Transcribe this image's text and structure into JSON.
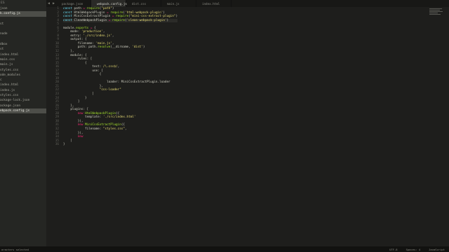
{
  "sidebar": {
    "title": "ES",
    "items": [
      {
        "label": "json"
      },
      {
        "label": "k.config.js",
        "active": true
      },
      {
        "label": ""
      },
      {
        "label": "st"
      },
      {
        "label": ""
      },
      {
        "label": "node"
      },
      {
        "label": ""
      },
      {
        "label": "dbox"
      },
      {
        "label": "st"
      },
      {
        "label": "index.html"
      },
      {
        "label": "main.css"
      },
      {
        "label": "main.js"
      },
      {
        "label": "styles.css"
      },
      {
        "label": "ode_modules"
      },
      {
        "label": "c"
      },
      {
        "label": "index.html"
      },
      {
        "label": "index.js"
      },
      {
        "label": "styles.css"
      },
      {
        "label": "ackage-lock.json"
      },
      {
        "label": "ackage.json"
      },
      {
        "label": "ebpack.config.js",
        "active": true
      }
    ]
  },
  "tabs": {
    "prev_icon": "◀",
    "next_icon": "▶",
    "items": [
      {
        "label": "package.json"
      },
      {
        "label": "webpack.config.js",
        "active": true
      },
      {
        "label": "dist.css"
      },
      {
        "label": "main.js"
      },
      {
        "label": "index.html"
      }
    ]
  },
  "code": {
    "current_line": 4,
    "lines": [
      [
        [
          "kw",
          "const"
        ],
        [
          "prop",
          " path "
        ],
        [
          "op",
          "="
        ],
        [
          "prop",
          " "
        ],
        [
          "fn",
          "require"
        ],
        [
          "prop",
          "("
        ],
        [
          "str",
          "\"path\""
        ],
        [
          "prop",
          ")"
        ]
      ],
      [
        [
          "kw",
          "const"
        ],
        [
          "prop",
          " HtmlWebpackPlugin "
        ],
        [
          "op",
          "="
        ],
        [
          "prop",
          " "
        ],
        [
          "fn",
          "require"
        ],
        [
          "prop",
          "("
        ],
        [
          "str",
          "'html-webpack-plugin'"
        ],
        [
          "prop",
          ")"
        ]
      ],
      [
        [
          "kw",
          "const"
        ],
        [
          "prop",
          " MiniCssExtractPlugin "
        ],
        [
          "op",
          "="
        ],
        [
          "prop",
          " "
        ],
        [
          "fn",
          "require"
        ],
        [
          "prop",
          "("
        ],
        [
          "str",
          "\"mini-css-extract-plugin\""
        ],
        [
          "prop",
          ")"
        ]
      ],
      [
        [
          "kw",
          "const"
        ],
        [
          "prop",
          " CleanWebpackPlugin "
        ],
        [
          "op",
          "="
        ],
        [
          "prop",
          " "
        ],
        [
          "fn",
          "require"
        ],
        [
          "prop",
          "("
        ],
        [
          "str",
          "'clean-webpack-plugin'"
        ],
        [
          "prop",
          ")"
        ]
      ],
      [
        [
          "prop",
          ""
        ]
      ],
      [
        [
          "prop",
          "module."
        ],
        [
          "fn",
          "exports"
        ],
        [
          "prop",
          " "
        ],
        [
          "op",
          "="
        ],
        [
          "prop",
          " {"
        ]
      ],
      [
        [
          "prop",
          "    mode: "
        ],
        [
          "str",
          "'production'"
        ],
        [
          "prop",
          ","
        ]
      ],
      [
        [
          "prop",
          "    entry: "
        ],
        [
          "str",
          "'./src/index.js'"
        ],
        [
          "prop",
          ","
        ]
      ],
      [
        [
          "prop",
          "    output: {"
        ]
      ],
      [
        [
          "prop",
          "        filename: "
        ],
        [
          "str",
          "'main.js'"
        ],
        [
          "prop",
          ","
        ]
      ],
      [
        [
          "prop",
          "        path: path."
        ],
        [
          "fn",
          "resolve"
        ],
        [
          "prop",
          "(__dirname, "
        ],
        [
          "str",
          "'dist'"
        ],
        [
          "prop",
          ")"
        ]
      ],
      [
        [
          "prop",
          "    },"
        ]
      ],
      [
        [
          "prop",
          "    module: {"
        ]
      ],
      [
        [
          "prop",
          "        rules: ["
        ]
      ],
      [
        [
          "prop",
          "            {"
        ]
      ],
      [
        [
          "prop",
          "                test: "
        ],
        [
          "str",
          "/\\.css$/"
        ],
        [
          "prop",
          ","
        ]
      ],
      [
        [
          "prop",
          "                use: ["
        ]
      ],
      [
        [
          "prop",
          "                    {"
        ]
      ],
      [
        [
          "prop",
          ""
        ]
      ],
      [
        [
          "prop",
          "                        loader: MiniCssExtractPlugin.loader"
        ]
      ],
      [
        [
          "prop",
          "                    },"
        ]
      ],
      [
        [
          "prop",
          "                    "
        ],
        [
          "str",
          "\"css-loader\""
        ]
      ],
      [
        [
          "prop",
          "                ]"
        ]
      ],
      [
        [
          "prop",
          "            }"
        ]
      ],
      [
        [
          "prop",
          "        ]"
        ]
      ],
      [
        [
          "prop",
          "    },"
        ]
      ],
      [
        [
          "prop",
          "    plugins: ["
        ]
      ],
      [
        [
          "prop",
          "        "
        ],
        [
          "op",
          "new"
        ],
        [
          "prop",
          " "
        ],
        [
          "fn",
          "HtmlWebpackPlugin"
        ],
        [
          "prop",
          "({"
        ]
      ],
      [
        [
          "prop",
          "            template: "
        ],
        [
          "str",
          "'./src/index.html'"
        ]
      ],
      [
        [
          "prop",
          "        }),"
        ]
      ],
      [
        [
          "prop",
          "        "
        ],
        [
          "op",
          "new"
        ],
        [
          "prop",
          " "
        ],
        [
          "fn",
          "MiniCssExtractPlugin"
        ],
        [
          "prop",
          "({"
        ]
      ],
      [
        [
          "prop",
          "            filename: "
        ],
        [
          "str",
          "\"styles.css\""
        ],
        [
          "prop",
          ","
        ]
      ],
      [
        [
          "prop",
          "        }),"
        ]
      ],
      [
        [
          "prop",
          "        "
        ],
        [
          "op",
          "new"
        ],
        [
          "prop",
          " "
        ]
      ],
      [
        [
          "prop",
          "    ]"
        ]
      ],
      [
        [
          "prop",
          "}"
        ]
      ]
    ]
  },
  "status": {
    "left": "aracters selected",
    "encoding": "UTF-8",
    "indent": "Spaces: 4",
    "syntax": "JavaScript"
  }
}
